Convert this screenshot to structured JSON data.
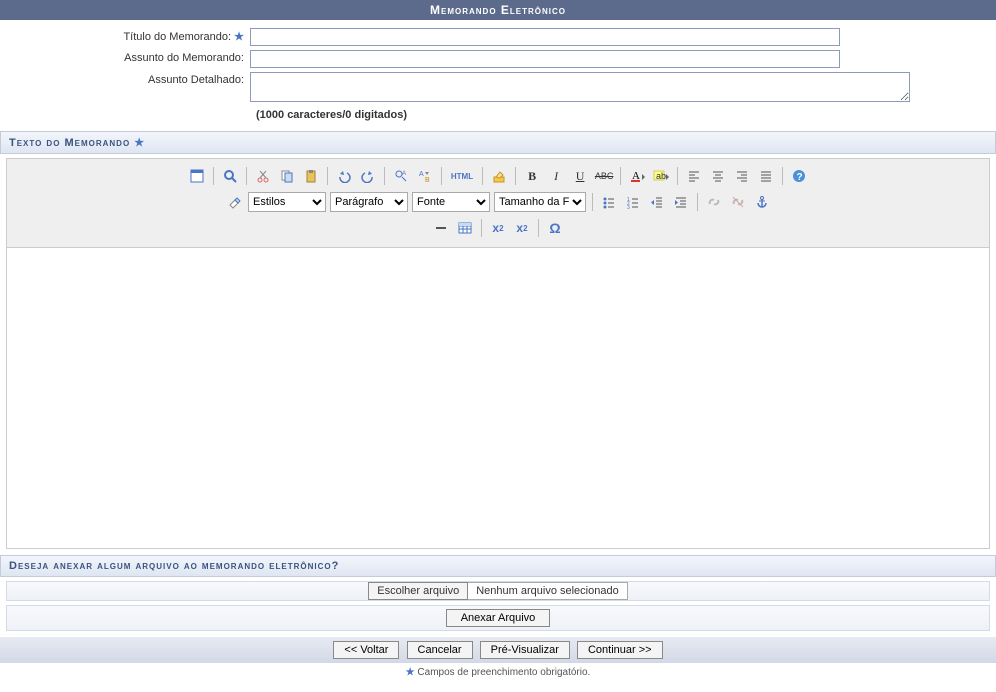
{
  "header": {
    "title": "Memorando Eletrônico"
  },
  "form": {
    "titulo_label": "Título do Memorando:",
    "titulo_value": "",
    "assunto_label": "Assunto do Memorando:",
    "assunto_value": "",
    "detalhado_label": "Assunto Detalhado:",
    "detalhado_value": "",
    "char_count": "(1000 caracteres/0 digitados)"
  },
  "section_texto": {
    "title": "Texto do Memorando"
  },
  "toolbar": {
    "selects": {
      "estilos": "Estilos",
      "paragrafo": "Parágrafo",
      "fonte": "Fonte",
      "tamanho": "Tamanho da Fo"
    },
    "html_label": "HTML"
  },
  "section_attach": {
    "title": "Deseja anexar algum arquivo ao memorando eletrônico?",
    "choose_label": "Escolher arquivo",
    "no_file": "Nenhum arquivo selecionado",
    "anexar": "Anexar Arquivo"
  },
  "footer": {
    "voltar": "<< Voltar",
    "cancelar": "Cancelar",
    "preview": "Pré-Visualizar",
    "continuar": "Continuar >>"
  },
  "legend": {
    "text": "Campos de preenchimento obrigatório."
  }
}
